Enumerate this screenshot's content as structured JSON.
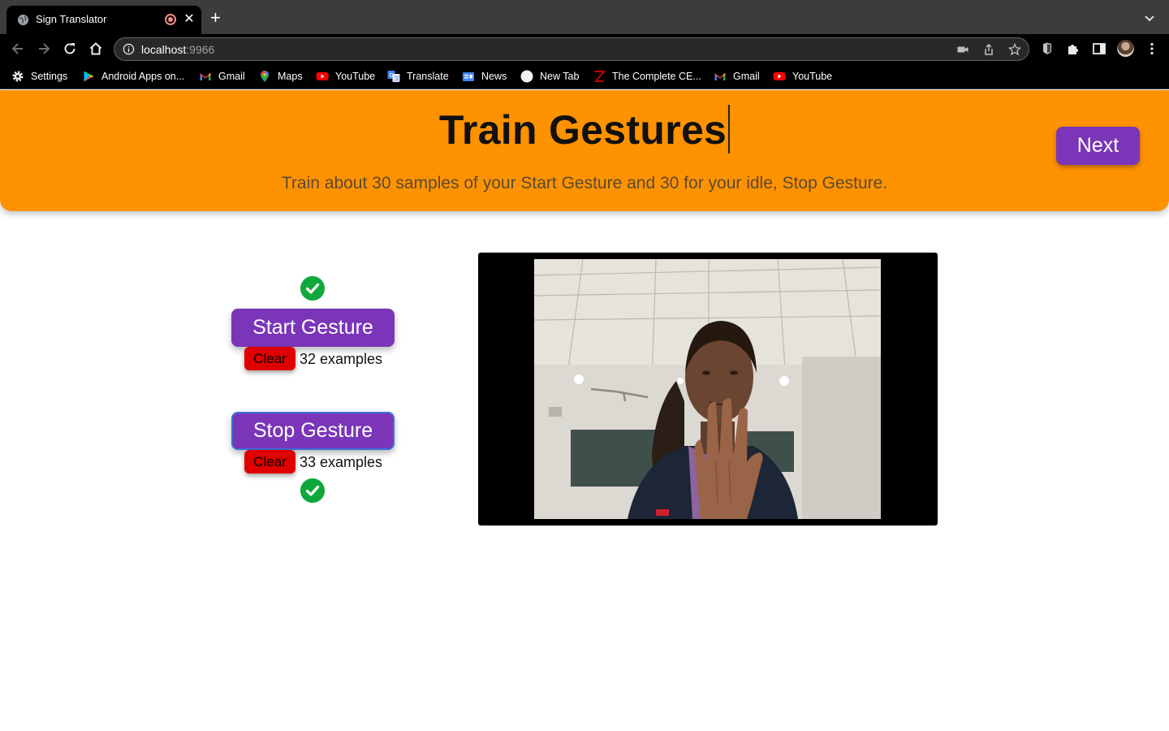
{
  "browser": {
    "tab": {
      "title": "Sign Translator",
      "favicon": "globe-icon",
      "recording": true
    },
    "address": {
      "host": "localhost",
      "port": ":9966"
    },
    "bookmarks": [
      {
        "label": "Settings",
        "icon": "gear-icon"
      },
      {
        "label": "Android Apps on...",
        "icon": "play-store-icon"
      },
      {
        "label": "Gmail",
        "icon": "gmail-icon"
      },
      {
        "label": "Maps",
        "icon": "maps-pin-icon"
      },
      {
        "label": "YouTube",
        "icon": "youtube-icon"
      },
      {
        "label": "Translate",
        "icon": "translate-icon"
      },
      {
        "label": "News",
        "icon": "news-icon"
      },
      {
        "label": "New Tab",
        "icon": "new-tab-icon"
      },
      {
        "label": "The Complete CE...",
        "icon": "z-logo-icon"
      },
      {
        "label": "Gmail",
        "icon": "gmail-icon"
      },
      {
        "label": "YouTube",
        "icon": "youtube-icon"
      }
    ]
  },
  "header": {
    "title": "Train Gestures",
    "subtitle": "Train about 30 samples of your Start Gesture and 30 for your idle, Stop Gesture.",
    "next_label": "Next"
  },
  "gestures": [
    {
      "label": "Start Gesture",
      "clear_label": "Clear",
      "count_text": "32 examples",
      "trained": true
    },
    {
      "label": "Stop Gesture",
      "clear_label": "Clear",
      "count_text": "33 examples",
      "trained": true
    }
  ],
  "colors": {
    "header_bg": "#ff9200",
    "button_purple": "#7b35b8",
    "clear_red": "#e00000",
    "check_green": "#10a83c"
  }
}
